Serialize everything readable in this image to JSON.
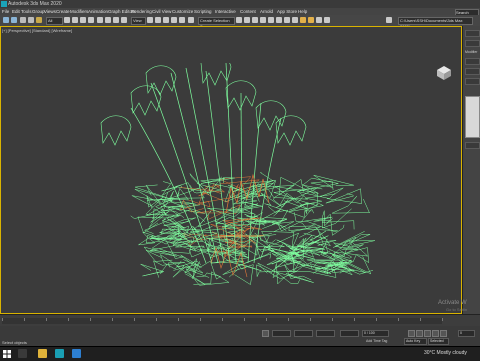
{
  "window": {
    "title": "Autodesk 3ds Max 2020",
    "sign_in": "Sign In"
  },
  "menu": {
    "items": [
      "File",
      "Edit",
      "Tools",
      "Group",
      "Views",
      "Create",
      "Modifiers",
      "Animation",
      "Graph Editors",
      "Rendering",
      "Civil View",
      "Customize",
      "Scripting",
      "Interactive",
      "Content",
      "Arnold",
      "App Store",
      "Help"
    ],
    "search_placeholder": "Search"
  },
  "toolbar": {
    "view_dropdown": "View",
    "selection_set": "Create Selection Se",
    "workspace_path": "C:\\Users\\SSH\\Documents\\3ds Max 2020\\"
  },
  "viewport": {
    "label": "[+] [Perspective] [Standard] [Wireframe]"
  },
  "right_panel": {
    "label_a": "Modifier",
    "label_b": "Auto Select"
  },
  "status": {
    "selection": "Select objects",
    "frame": "0 / 100",
    "key_mode": "Auto Key",
    "selected": "Selected",
    "add_time_tag": "Add Time Tag",
    "fps_field": "0"
  },
  "watermark": {
    "line1": "Activate W",
    "line2": "Go to Settin"
  },
  "taskbar": {
    "weather": "30°C  Mostly cloudy"
  },
  "colors": {
    "accent": "#d9b300",
    "grass": "#7fff9f",
    "orange": "#e0783a"
  }
}
